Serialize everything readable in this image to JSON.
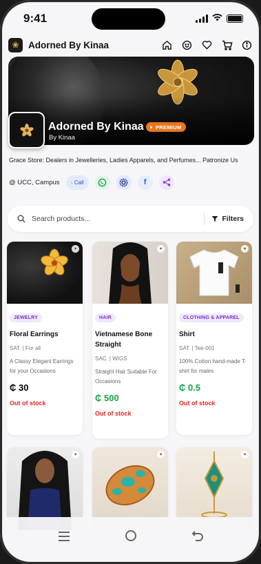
{
  "status_bar": {
    "time": "9:41"
  },
  "app_bar": {
    "brand": "Adorned By Kinaa",
    "actions": [
      "home-icon",
      "sticker-smile-icon",
      "heart-icon",
      "cart-icon",
      "info-icon"
    ]
  },
  "store": {
    "name": "Adorned By Kinaa",
    "badge": "PREMIUM",
    "by": "By Kinaa",
    "description": "Grace Store: Dealers in Jewelleries, Ladies Apparels, and Perfumes... Patronize Us",
    "location": "@ UCC, Campus",
    "call_label": "Call",
    "contacts": [
      "phone-icon",
      "whatsapp-icon",
      "signal-icon",
      "facebook-icon",
      "share-icon"
    ]
  },
  "search": {
    "placeholder": "Search products...",
    "filters_label": "Filters"
  },
  "products": [
    {
      "category": "JEWELRY",
      "name": "Floral Earrings",
      "meta": "SAT. | For all",
      "description": "A Classy Elegant Earrings for your Occasions",
      "price": "₵ 30",
      "price_color": "#111111",
      "stock": "Out of stock"
    },
    {
      "category": "HAIR",
      "name": "Vietnamese Bone Straight",
      "meta": "SAC. | WIGS",
      "description": "Straight Hair Suitable For Occasions",
      "price": "₵ 500",
      "price_color": "#16a34a",
      "stock": "Out of stock"
    },
    {
      "category": "CLOTHING & APPAREL",
      "name": "Shirt",
      "meta": "SAT. | Tee-001",
      "description": "100% Cotton hand-made T-shirt for males",
      "price": "₵ 0.5",
      "price_color": "#16a34a",
      "stock": "Out of stock"
    }
  ],
  "colors": {
    "accent": "#e8761c",
    "category_bg": "#f2e8fc",
    "category_text": "#7a2fcf",
    "out_of_stock": "#e02424"
  },
  "bottom_nav": [
    "menu-icon",
    "home-circle-icon",
    "back-icon"
  ]
}
